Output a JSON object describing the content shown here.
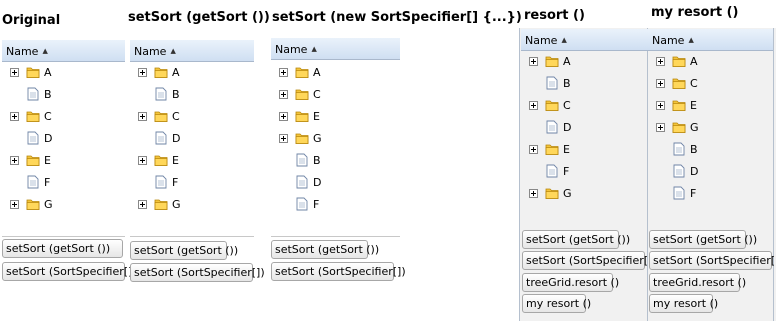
{
  "panels": [
    {
      "title": "Original",
      "column_header": "Name",
      "rows": [
        {
          "label": "A",
          "type": "folder"
        },
        {
          "label": "B",
          "type": "file"
        },
        {
          "label": "C",
          "type": "folder"
        },
        {
          "label": "D",
          "type": "file"
        },
        {
          "label": "E",
          "type": "folder"
        },
        {
          "label": "F",
          "type": "file"
        },
        {
          "label": "G",
          "type": "folder"
        }
      ],
      "buttons": [
        "setSort (getSort ())",
        "setSort (SortSpecifier[])"
      ]
    },
    {
      "title": "setSort (getSort ())",
      "column_header": "Name",
      "rows": [
        {
          "label": "A",
          "type": "folder"
        },
        {
          "label": "B",
          "type": "file"
        },
        {
          "label": "C",
          "type": "folder"
        },
        {
          "label": "D",
          "type": "file"
        },
        {
          "label": "E",
          "type": "folder"
        },
        {
          "label": "F",
          "type": "file"
        },
        {
          "label": "G",
          "type": "folder"
        }
      ],
      "buttons": [
        "setSort (getSort ())",
        "setSort (SortSpecifier[])"
      ]
    },
    {
      "title": "setSort (new SortSpecifier[] {...})",
      "column_header": "Name",
      "rows": [
        {
          "label": "A",
          "type": "folder"
        },
        {
          "label": "C",
          "type": "folder"
        },
        {
          "label": "E",
          "type": "folder"
        },
        {
          "label": "G",
          "type": "folder"
        },
        {
          "label": "B",
          "type": "file"
        },
        {
          "label": "D",
          "type": "file"
        },
        {
          "label": "F",
          "type": "file"
        }
      ],
      "buttons": [
        "setSort (getSort ())",
        "setSort (SortSpecifier[])"
      ]
    },
    {
      "title": "resort ()",
      "column_header": "Name",
      "rows": [
        {
          "label": "A",
          "type": "folder"
        },
        {
          "label": "B",
          "type": "file"
        },
        {
          "label": "C",
          "type": "folder"
        },
        {
          "label": "D",
          "type": "file"
        },
        {
          "label": "E",
          "type": "folder"
        },
        {
          "label": "F",
          "type": "file"
        },
        {
          "label": "G",
          "type": "folder"
        }
      ],
      "buttons": [
        "setSort (getSort ())",
        "setSort (SortSpecifier[])",
        "treeGrid.resort ()",
        "my resort ()"
      ]
    },
    {
      "title": "my resort ()",
      "column_header": "Name",
      "rows": [
        {
          "label": "A",
          "type": "folder"
        },
        {
          "label": "C",
          "type": "folder"
        },
        {
          "label": "E",
          "type": "folder"
        },
        {
          "label": "G",
          "type": "folder"
        },
        {
          "label": "B",
          "type": "file"
        },
        {
          "label": "D",
          "type": "file"
        },
        {
          "label": "F",
          "type": "file"
        }
      ],
      "buttons": [
        "setSort (getSort ())",
        "setSort (SortSpecifier[])",
        "treeGrid.resort ()",
        "my resort ()"
      ]
    }
  ]
}
